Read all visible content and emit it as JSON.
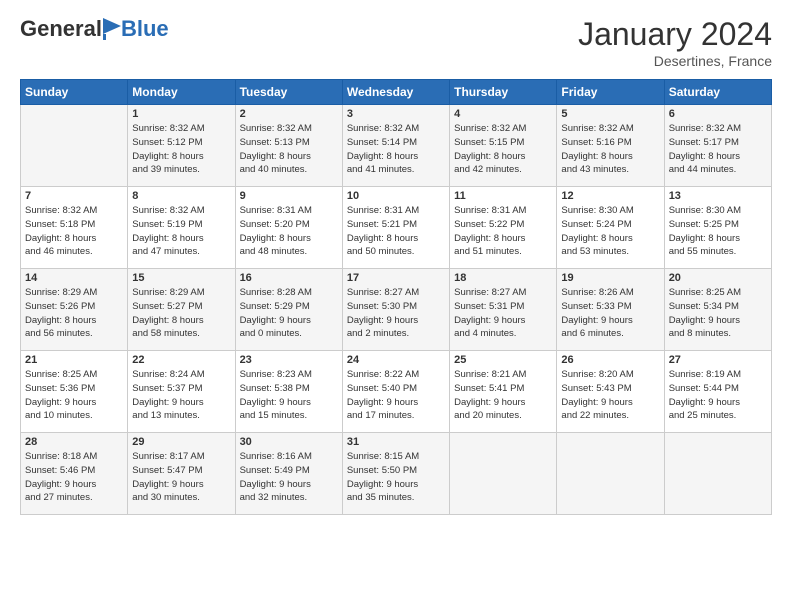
{
  "logo": {
    "general": "General",
    "blue": "Blue"
  },
  "title": "January 2024",
  "location": "Desertines, France",
  "days_header": [
    "Sunday",
    "Monday",
    "Tuesday",
    "Wednesday",
    "Thursday",
    "Friday",
    "Saturday"
  ],
  "weeks": [
    [
      {
        "day": "",
        "content": ""
      },
      {
        "day": "1",
        "content": "Sunrise: 8:32 AM\nSunset: 5:12 PM\nDaylight: 8 hours\nand 39 minutes."
      },
      {
        "day": "2",
        "content": "Sunrise: 8:32 AM\nSunset: 5:13 PM\nDaylight: 8 hours\nand 40 minutes."
      },
      {
        "day": "3",
        "content": "Sunrise: 8:32 AM\nSunset: 5:14 PM\nDaylight: 8 hours\nand 41 minutes."
      },
      {
        "day": "4",
        "content": "Sunrise: 8:32 AM\nSunset: 5:15 PM\nDaylight: 8 hours\nand 42 minutes."
      },
      {
        "day": "5",
        "content": "Sunrise: 8:32 AM\nSunset: 5:16 PM\nDaylight: 8 hours\nand 43 minutes."
      },
      {
        "day": "6",
        "content": "Sunrise: 8:32 AM\nSunset: 5:17 PM\nDaylight: 8 hours\nand 44 minutes."
      }
    ],
    [
      {
        "day": "7",
        "content": "Sunrise: 8:32 AM\nSunset: 5:18 PM\nDaylight: 8 hours\nand 46 minutes."
      },
      {
        "day": "8",
        "content": "Sunrise: 8:32 AM\nSunset: 5:19 PM\nDaylight: 8 hours\nand 47 minutes."
      },
      {
        "day": "9",
        "content": "Sunrise: 8:31 AM\nSunset: 5:20 PM\nDaylight: 8 hours\nand 48 minutes."
      },
      {
        "day": "10",
        "content": "Sunrise: 8:31 AM\nSunset: 5:21 PM\nDaylight: 8 hours\nand 50 minutes."
      },
      {
        "day": "11",
        "content": "Sunrise: 8:31 AM\nSunset: 5:22 PM\nDaylight: 8 hours\nand 51 minutes."
      },
      {
        "day": "12",
        "content": "Sunrise: 8:30 AM\nSunset: 5:24 PM\nDaylight: 8 hours\nand 53 minutes."
      },
      {
        "day": "13",
        "content": "Sunrise: 8:30 AM\nSunset: 5:25 PM\nDaylight: 8 hours\nand 55 minutes."
      }
    ],
    [
      {
        "day": "14",
        "content": "Sunrise: 8:29 AM\nSunset: 5:26 PM\nDaylight: 8 hours\nand 56 minutes."
      },
      {
        "day": "15",
        "content": "Sunrise: 8:29 AM\nSunset: 5:27 PM\nDaylight: 8 hours\nand 58 minutes."
      },
      {
        "day": "16",
        "content": "Sunrise: 8:28 AM\nSunset: 5:29 PM\nDaylight: 9 hours\nand 0 minutes."
      },
      {
        "day": "17",
        "content": "Sunrise: 8:27 AM\nSunset: 5:30 PM\nDaylight: 9 hours\nand 2 minutes."
      },
      {
        "day": "18",
        "content": "Sunrise: 8:27 AM\nSunset: 5:31 PM\nDaylight: 9 hours\nand 4 minutes."
      },
      {
        "day": "19",
        "content": "Sunrise: 8:26 AM\nSunset: 5:33 PM\nDaylight: 9 hours\nand 6 minutes."
      },
      {
        "day": "20",
        "content": "Sunrise: 8:25 AM\nSunset: 5:34 PM\nDaylight: 9 hours\nand 8 minutes."
      }
    ],
    [
      {
        "day": "21",
        "content": "Sunrise: 8:25 AM\nSunset: 5:36 PM\nDaylight: 9 hours\nand 10 minutes."
      },
      {
        "day": "22",
        "content": "Sunrise: 8:24 AM\nSunset: 5:37 PM\nDaylight: 9 hours\nand 13 minutes."
      },
      {
        "day": "23",
        "content": "Sunrise: 8:23 AM\nSunset: 5:38 PM\nDaylight: 9 hours\nand 15 minutes."
      },
      {
        "day": "24",
        "content": "Sunrise: 8:22 AM\nSunset: 5:40 PM\nDaylight: 9 hours\nand 17 minutes."
      },
      {
        "day": "25",
        "content": "Sunrise: 8:21 AM\nSunset: 5:41 PM\nDaylight: 9 hours\nand 20 minutes."
      },
      {
        "day": "26",
        "content": "Sunrise: 8:20 AM\nSunset: 5:43 PM\nDaylight: 9 hours\nand 22 minutes."
      },
      {
        "day": "27",
        "content": "Sunrise: 8:19 AM\nSunset: 5:44 PM\nDaylight: 9 hours\nand 25 minutes."
      }
    ],
    [
      {
        "day": "28",
        "content": "Sunrise: 8:18 AM\nSunset: 5:46 PM\nDaylight: 9 hours\nand 27 minutes."
      },
      {
        "day": "29",
        "content": "Sunrise: 8:17 AM\nSunset: 5:47 PM\nDaylight: 9 hours\nand 30 minutes."
      },
      {
        "day": "30",
        "content": "Sunrise: 8:16 AM\nSunset: 5:49 PM\nDaylight: 9 hours\nand 32 minutes."
      },
      {
        "day": "31",
        "content": "Sunrise: 8:15 AM\nSunset: 5:50 PM\nDaylight: 9 hours\nand 35 minutes."
      },
      {
        "day": "",
        "content": ""
      },
      {
        "day": "",
        "content": ""
      },
      {
        "day": "",
        "content": ""
      }
    ]
  ]
}
